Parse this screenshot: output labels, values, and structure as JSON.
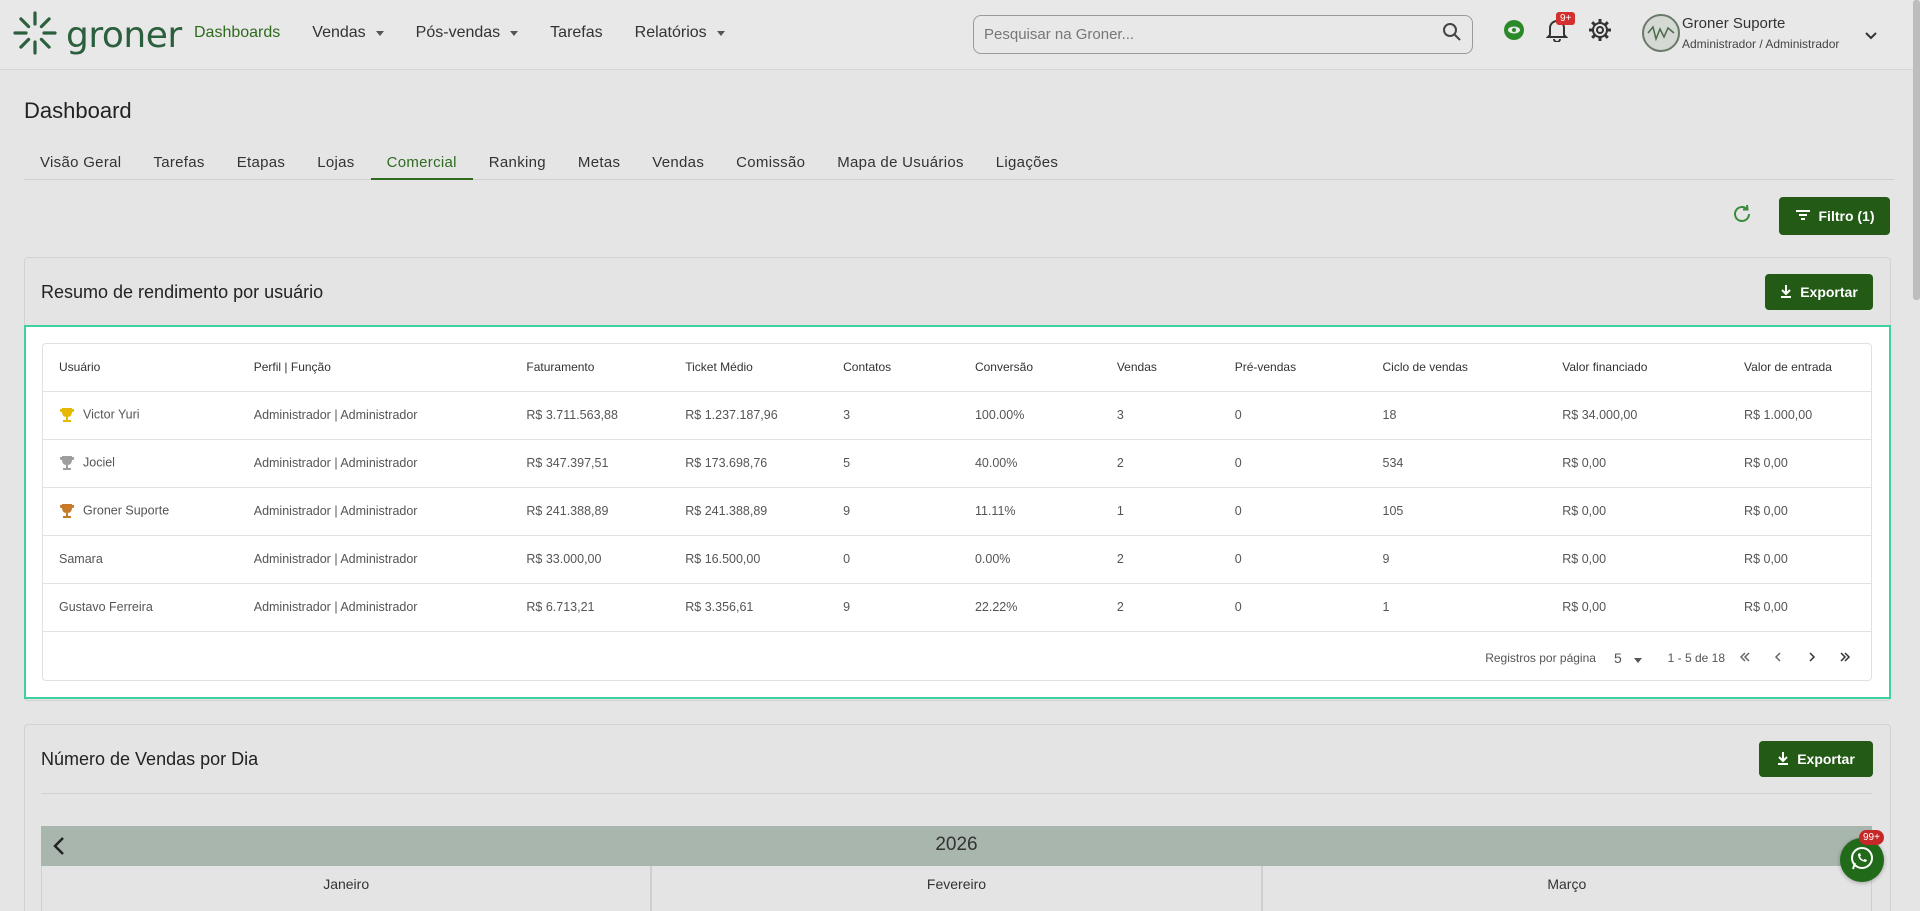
{
  "brand": {
    "name": "groner"
  },
  "nav": [
    {
      "label": "Dashboards",
      "has_caret": false,
      "active": true
    },
    {
      "label": "Vendas",
      "has_caret": true
    },
    {
      "label": "Pós-vendas",
      "has_caret": true
    },
    {
      "label": "Tarefas",
      "has_caret": false
    },
    {
      "label": "Relatórios",
      "has_caret": true
    }
  ],
  "search": {
    "placeholder": "Pesquisar na Groner..."
  },
  "notifications": {
    "count": "9+"
  },
  "user": {
    "name": "Groner Suporte",
    "role": "Administrador / Administrador"
  },
  "page": {
    "title": "Dashboard"
  },
  "tabs": [
    "Visão Geral",
    "Tarefas",
    "Etapas",
    "Lojas",
    "Comercial",
    "Ranking",
    "Metas",
    "Vendas",
    "Comissão",
    "Mapa de Usuários",
    "Ligações"
  ],
  "active_tab": "Comercial",
  "filter_button": "Filtro (1)",
  "summary": {
    "title": "Resumo de rendimento por usuário",
    "export_label": "Exportar",
    "columns": [
      "Usuário",
      "Perfil | Função",
      "Faturamento",
      "Ticket Médio",
      "Contatos",
      "Conversão",
      "Vendas",
      "Pré-vendas",
      "Ciclo de vendas",
      "Valor financiado",
      "Valor de entrada"
    ],
    "rows": [
      {
        "trophy": "gold",
        "user": "Victor Yuri",
        "profile": "Administrador | Administrador",
        "revenue": "R$ 3.711.563,88",
        "ticket": "R$ 1.237.187,96",
        "contacts": "3",
        "conversion": "100.00%",
        "sales": "3",
        "presales": "0",
        "cycle": "18",
        "financed": "R$ 34.000,00",
        "entry": "R$ 1.000,00"
      },
      {
        "trophy": "silver",
        "user": "Jociel",
        "profile": "Administrador | Administrador",
        "revenue": "R$ 347.397,51",
        "ticket": "R$ 173.698,76",
        "contacts": "5",
        "conversion": "40.00%",
        "sales": "2",
        "presales": "0",
        "cycle": "534",
        "financed": "R$ 0,00",
        "entry": "R$ 0,00"
      },
      {
        "trophy": "bronze",
        "user": "Groner Suporte",
        "profile": "Administrador | Administrador",
        "revenue": "R$ 241.388,89",
        "ticket": "R$ 241.388,89",
        "contacts": "9",
        "conversion": "11.11%",
        "sales": "1",
        "presales": "0",
        "cycle": "105",
        "financed": "R$ 0,00",
        "entry": "R$ 0,00"
      },
      {
        "trophy": "",
        "user": "Samara",
        "profile": "Administrador | Administrador",
        "revenue": "R$ 33.000,00",
        "ticket": "R$ 16.500,00",
        "contacts": "0",
        "conversion": "0.00%",
        "sales": "2",
        "presales": "0",
        "cycle": "9",
        "financed": "R$ 0,00",
        "entry": "R$ 0,00"
      },
      {
        "trophy": "",
        "user": "Gustavo Ferreira",
        "profile": "Administrador | Administrador",
        "revenue": "R$ 6.713,21",
        "ticket": "R$ 3.356,61",
        "contacts": "9",
        "conversion": "22.22%",
        "sales": "2",
        "presales": "0",
        "cycle": "1",
        "financed": "R$ 0,00",
        "entry": "R$ 0,00"
      }
    ],
    "pager": {
      "rows_label": "Registros por página",
      "page_size": "5",
      "range": "1 - 5 de 18"
    }
  },
  "sales_per_day": {
    "title": "Número de Vendas por Dia",
    "export_label": "Exportar",
    "year": "2026",
    "months": [
      "Janeiro",
      "Fevereiro",
      "Março"
    ]
  },
  "chat_badge": "99+",
  "colors": {
    "accent": "#2f6b1f",
    "button": "#225a16",
    "highlight": "#3fcfa3",
    "gold": "#e6b800",
    "silver": "#9e9e9e",
    "bronze": "#c77a2a"
  }
}
